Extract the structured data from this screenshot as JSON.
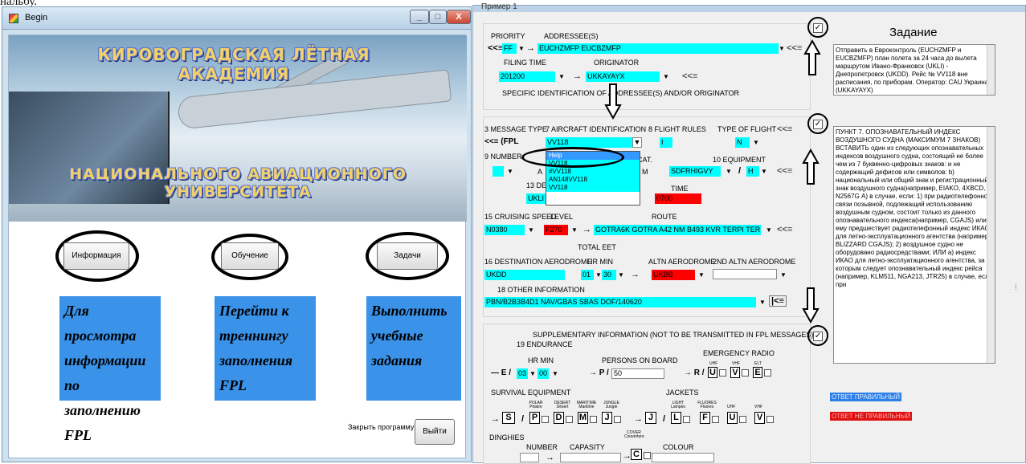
{
  "top_caption": "нальбу.",
  "left_window": {
    "title": "Begin",
    "btn_min": "_",
    "btn_max": "□",
    "btn_close": "X",
    "banner_title1": "КИРОВОГРАДСКАЯ ЛЁТНАЯ АКАДЕМИЯ",
    "banner_title2": "НАЦИОНАЛЬНОГО АВИАЦИОННОГО УНИВЕРСИТЕТА",
    "buttons": {
      "info": "Информация",
      "training": "Обучение",
      "tasks": "Задачи",
      "exit": "Выйти"
    },
    "descriptions": {
      "info": "Для просмотра информации по заполнению FPL",
      "training": "Перейти к треннингу заполнения FPL",
      "tasks": "Выполнить учебные задания"
    },
    "close_label": "Закрыть программу"
  },
  "right_window": {
    "title": "Пример 1",
    "priority_label": "PRIORITY",
    "priority_prefix": "<<≡",
    "priority_value": "FF",
    "addressee_label": "ADDRESSEE(S)",
    "addressee_value": "EUCHZMFP EUCBZMFP",
    "filing_time_label": "FILING TIME",
    "filing_time_value": "201200",
    "originator_label": "ORIGINATOR",
    "originator_value": "UKKAYAYX",
    "specific_id_label": "SPECIFIC IDENTIFICATION OF ADDRESSEE(S) AND/OR ORIGINATOR",
    "msg_type_label": "3 MESSAGE TYPE",
    "msg_type_value": "<<≡ (FPL",
    "aircraft_id_label": "7 AIRCRAFT IDENTIFICATION",
    "aircraft_id_value": "VV118",
    "flight_rules_label": "8 FLIGHT RULES",
    "flight_rules_value": "I",
    "type_of_flight_label": "TYPE OF FLIGHT",
    "type_of_flight_value": "N",
    "number_label": "9 NUMBER",
    "type_aircraft_short": "A",
    "wake_label": "URBULENCE CAT.",
    "wake_value": "M",
    "equipment_label": "10 EQUIPMENT",
    "equipment_value": "SDFRHIGVY",
    "equipment_value2": "H",
    "dep_label": "13 DEP",
    "dep_value": "UKLI",
    "time_label": "TIME",
    "time_value": "0700",
    "dropdown_items": [
      "Help",
      "VV118",
      "#VV118",
      "AN148VV118",
      "VV118"
    ],
    "cruise_label": "15 CRUISING SPEED",
    "level_label": "LEVEL",
    "route_label": "ROUTE",
    "cruise_value": "N0380",
    "level_value": "F270",
    "route_value": "GOTRA6K GOTRA A42 NM B493 KVR TERPI TERPI 5C",
    "total_eet_label": "TOTAL EET",
    "dest_label": "16 DESTINATION AERODROME",
    "hr_min_label": "HR  MIN",
    "altn_label": "ALTN AERODROME",
    "altn2_label": "2ND ALTN AERODROME",
    "dest_value": "UKDD",
    "eet_hr": "01",
    "eet_min": "30",
    "altn_value": "UKBB",
    "other_label": "18 OTHER INFORMATION",
    "other_value": "PBN/B2B3B4D1 NAV/GBAS SBAS DOF/140620",
    "supp_label": "SUPPLEMENTARY INFORMATION (NOT TO BE TRANSMITTED IN FPL MESSAGES)",
    "endurance_label": "19 ENDURANCE",
    "end_hr_min": "HR  MIN",
    "persons_label": "PERSONS ON BOARD",
    "emergency_label": "EMERGENCY RADIO",
    "end_prefix": "— E /",
    "end_hr": "03",
    "end_min": "00",
    "persons_prefix": "→ P /",
    "persons_value": "50",
    "radio_prefix": "→ R /",
    "survival_label": "SURVIVAL EQUIPMENT",
    "jackets_label": "JACKETS",
    "s_letter": "S",
    "p_letter": "P",
    "d_letter": "D",
    "m_letter": "M",
    "j_letter": "J",
    "j2_letter": "J",
    "l_letter": "L",
    "f_letter": "F",
    "u_letter": "U",
    "v_letter": "V",
    "e_letter": "E",
    "tiny": {
      "polar": "POLAR Polaire",
      "desert": "DESERT Désert",
      "maritime": "MARITIME Maritime",
      "jungle": "JUNGLE Jungle",
      "light": "LIGHT Lampes",
      "fluores": "FLUORES Fluores",
      "uhf": "UHF",
      "vhf": "VHF",
      "elt": "ELT"
    },
    "dinghies_label": "DINGHIES",
    "number_label2": "NUMBER",
    "capacity_label": "CAPASITY",
    "cover_label": "COVER Couverture",
    "c_letter": "C",
    "colour_label": "COLOUR",
    "task_title": "Задание",
    "task_text": "Отправить в Евроконтроль (EUCHZMFP и EUCBZMFP) план полета за 24 часа до вылета маршрутом Ивано-Франковск (UKLI) - Днепропетровск (UKDD). Рейс № VV118 вне расписания, по приборам. Оператор: CAU Украина (UKKAYAYX)",
    "help_text": "ПУНКТ 7. ОПОЗНАВАТЕЛЬНЫЙ ИНДЕКС ВОЗДУШНОГО СУДНА (МАКСИМУМ 7 ЗНАКОВ) ВСТАВИТЬ один из следующих опознавательных индексов воздушного судна, состоящий не более чем из 7 буквенно-цифровых знаков: и не содержащий дефисов или символов: b) национальный или общий знак и регистрационный знак воздушного судна(например, EIAKO, 4XBCD, N2567G  А) в случае, если: 1) при радиотелефонной связи позывной, подлежащий использованию воздушным судном, состоит только из данного опознавательного индекса(например, CGAJS) или ему предшествует радиотелефонный индекс ИКАО для летно-эксплуатационного агентства (например, BLIZZARD CGAJS); 2) воздушное судно не оборудовано радиосредствами; ИЛИ а) индекс ИКАО для летно-эксплуатационного агентства, за которым следует опознавательный индекс рейса (например, KLM511, NGA213, JTR25) в случае, если при",
    "answer_ok": "ОТВЕТ ПРАВИЛЬНЫЙ",
    "answer_bad": "ОТВЕТ НЕ ПРАВИЛЬНЫЙ"
  }
}
